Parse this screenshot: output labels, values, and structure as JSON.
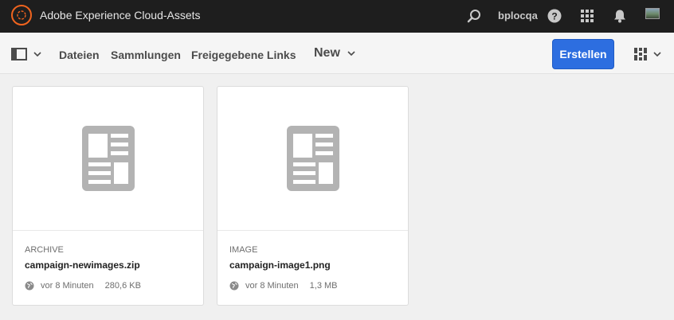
{
  "header": {
    "app_title": "Adobe Experience Cloud-Assets",
    "user_name": "bplocqa",
    "icons": [
      "adobe-logo",
      "search-icon",
      "help-icon",
      "apps-grid-icon",
      "notifications-bell-icon",
      "user-avatar"
    ]
  },
  "actionbar": {
    "nav_links": [
      "Dateien",
      "Sammlungen",
      "Freigegebene Links"
    ],
    "filter_label": "New",
    "create_label": "Erstellen"
  },
  "colors": {
    "topbar": "#1e1e1e",
    "logo_accent": "#f0641e",
    "primary_button": "#2d6ee0",
    "placeholder_icon": "#b3b3b3"
  },
  "cards": [
    {
      "type": "ARCHIVE",
      "name": "campaign-newimages.zip",
      "modified": "vor 8 Minuten",
      "size": "280,6 KB"
    },
    {
      "type": "IMAGE",
      "name": "campaign-image1.png",
      "modified": "vor 8 Minuten",
      "size": "1,3 MB"
    }
  ]
}
